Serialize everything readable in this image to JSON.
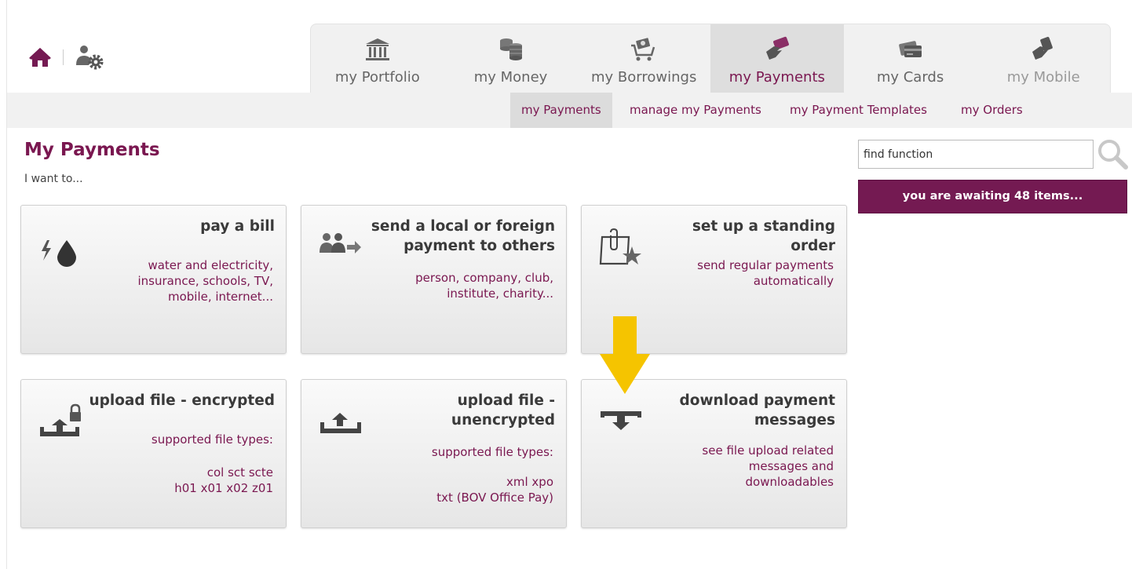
{
  "header": {
    "home_icon": "home-icon",
    "settings_icon": "user-settings-icon"
  },
  "tabs": [
    {
      "label": "my Portfolio",
      "icon": "bank-icon",
      "state": "normal"
    },
    {
      "label": "my Money",
      "icon": "coins-icon",
      "state": "normal"
    },
    {
      "label": "my Borrowings",
      "icon": "cart-money-icon",
      "state": "normal"
    },
    {
      "label": "my Payments",
      "icon": "hand-card-icon",
      "state": "active"
    },
    {
      "label": "my Cards",
      "icon": "cards-icon",
      "state": "normal"
    },
    {
      "label": "my Mobile",
      "icon": "hand-phone-icon",
      "state": "disabled"
    }
  ],
  "subnav": [
    {
      "label": "my Payments",
      "active": true
    },
    {
      "label": "manage my Payments",
      "active": false
    },
    {
      "label": "my Payment Templates",
      "active": false
    },
    {
      "label": "my Orders",
      "active": false
    }
  ],
  "page": {
    "title": "My Payments",
    "subtitle": "I want to..."
  },
  "search": {
    "value": "find function"
  },
  "awaiting": {
    "label": "you are awaiting 48 items..."
  },
  "cards": [
    {
      "title": "pay a bill",
      "desc": "water and electricity,\ninsurance, schools, TV,\nmobile, internet...",
      "icon": "utility-bill-icon"
    },
    {
      "title": "send a local or foreign payment to others",
      "desc": "person, company, club,\ninstitute, charity...",
      "icon": "people-transfer-icon"
    },
    {
      "title": "set up a standing order",
      "desc": "send regular payments\nautomatically",
      "icon": "clipboard-star-icon"
    },
    {
      "title": "upload file - encrypted",
      "desc": "supported file types:",
      "desc2": "col sct scte\nh01 x01 x02 z01",
      "icon": "upload-lock-icon"
    },
    {
      "title": "upload file - unencrypted",
      "desc": "supported file types:",
      "desc2": "xml xpo\ntxt (BOV Office Pay)",
      "icon": "upload-icon"
    },
    {
      "title": "download payment messages",
      "desc": "see file upload related\nmessages and\ndownloadables",
      "icon": "download-icon"
    }
  ],
  "colors": {
    "brand": "#741a52",
    "arrow": "#f5c400",
    "icon_grey": "#555555"
  }
}
